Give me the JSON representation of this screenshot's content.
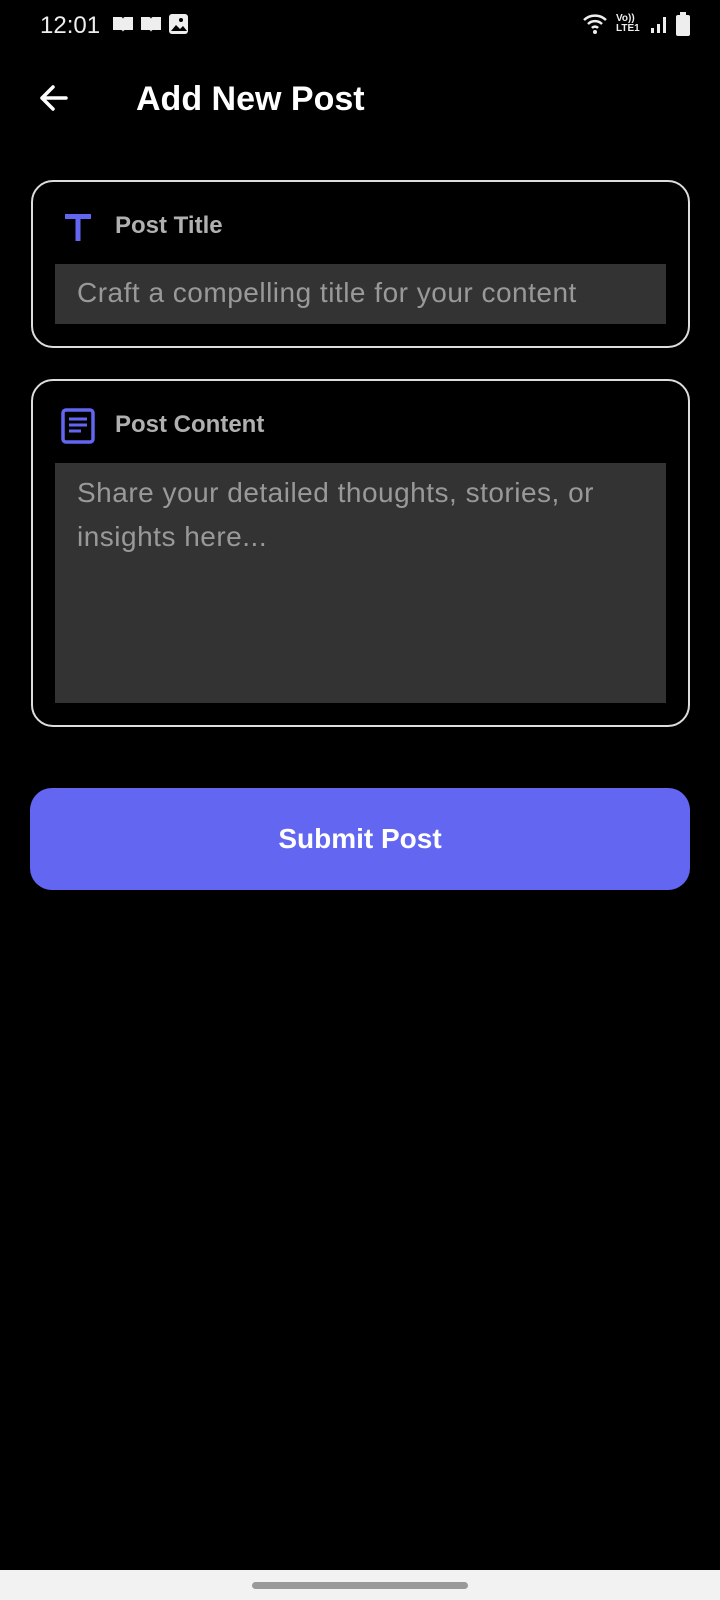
{
  "status_bar": {
    "time": "12:01",
    "network_label": "Vo)) LTE1"
  },
  "app_bar": {
    "title": "Add New Post"
  },
  "post_title": {
    "label": "Post Title",
    "placeholder": "Craft a compelling title for your content",
    "value": ""
  },
  "post_content": {
    "label": "Post Content",
    "placeholder": "Share your detailed thoughts, stories, or insights here...",
    "value": ""
  },
  "submit_label": "Submit Post",
  "colors": {
    "accent": "#6366f1",
    "field_bg": "#333333",
    "border": "#dddddd"
  }
}
